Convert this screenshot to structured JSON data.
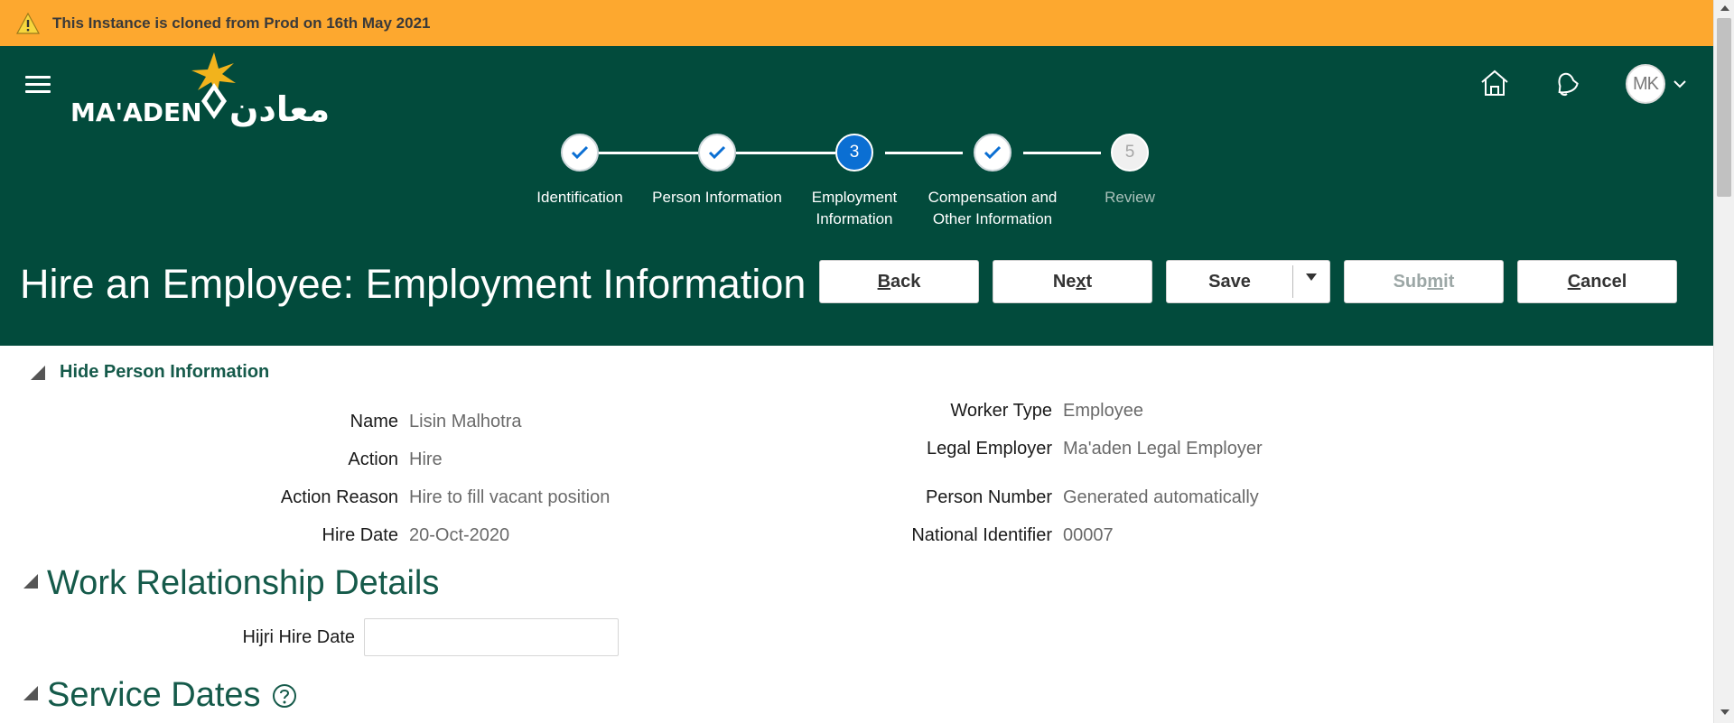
{
  "banner": {
    "text": "This Instance is cloned from Prod on 16th May 2021",
    "color": "#fda82f"
  },
  "header": {
    "background": "#024b3c",
    "logo_text": "MA'ADEN",
    "logo_arabic": "معادن",
    "user_initials": "MK"
  },
  "train": {
    "stops": [
      {
        "label": "Identification",
        "state": "done"
      },
      {
        "label": "Person Information",
        "state": "done"
      },
      {
        "number": "3",
        "label_line1": "Employment",
        "label_line2": "Information",
        "state": "current"
      },
      {
        "label_line1": "Compensation and",
        "label_line2": "Other Information",
        "state": "done"
      },
      {
        "number": "5",
        "label": "Review",
        "state": "future"
      }
    ]
  },
  "page": {
    "title": "Hire an Employee: Employment Information"
  },
  "buttons": {
    "back": {
      "pre": "",
      "u": "B",
      "post": "ack"
    },
    "next": {
      "pre": "Ne",
      "u": "x",
      "post": "t"
    },
    "save": "Save",
    "submit": {
      "pre": "Sub",
      "u": "m",
      "post": "it"
    },
    "cancel": {
      "pre": "",
      "u": "C",
      "post": "ancel"
    }
  },
  "person": {
    "toggle_label": "Hide Person Information",
    "left": [
      {
        "label": "Name",
        "value": "Lisin Malhotra"
      },
      {
        "label": "Action",
        "value": "Hire"
      },
      {
        "label": "Action Reason",
        "value": "Hire to fill vacant position"
      },
      {
        "label": "Hire Date",
        "value": "20-Oct-2020"
      }
    ],
    "right": [
      {
        "label": "Worker Type",
        "value": "Employee"
      },
      {
        "label": "Legal Employer",
        "value": "Ma'aden Legal Employer"
      },
      {
        "label": "Person Number",
        "value": "Generated automatically"
      },
      {
        "label": "National Identifier",
        "value": "00007"
      }
    ]
  },
  "work_relationship": {
    "title": "Work Relationship Details",
    "hijri_label": "Hijri Hire Date",
    "hijri_value": ""
  },
  "service_dates": {
    "title": "Service Dates"
  }
}
